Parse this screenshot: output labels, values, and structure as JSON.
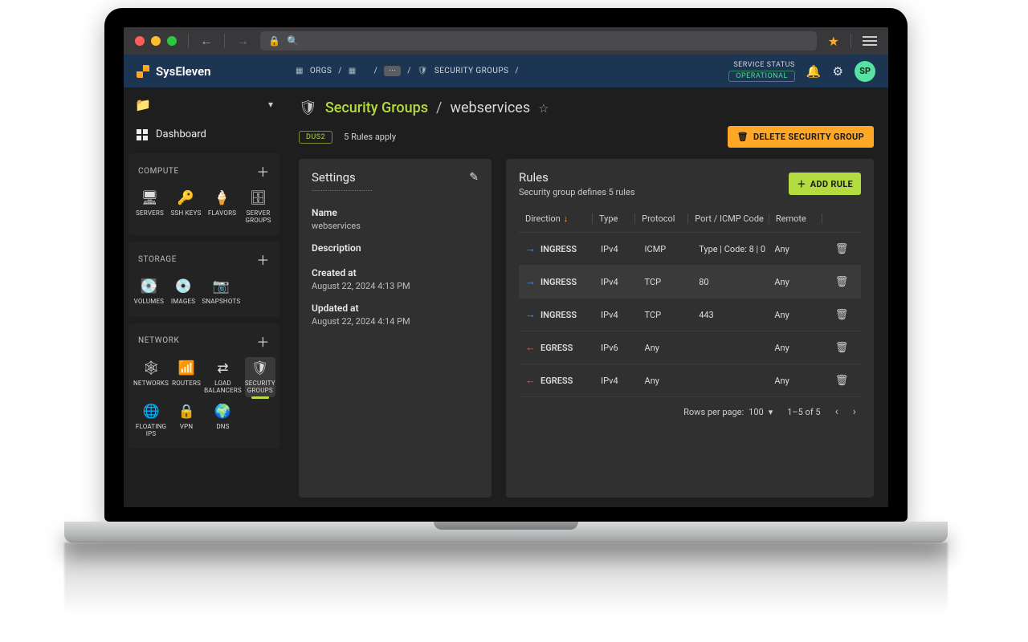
{
  "brand": "SysEleven",
  "browser": {
    "star_title": "Bookmark"
  },
  "breadcrumb": {
    "orgs": "ORGS",
    "security_groups": "SECURITY GROUPS"
  },
  "service_status": {
    "label": "SERVICE STATUS",
    "value": "OPERATIONAL"
  },
  "avatar": "SP",
  "sidebar": {
    "dashboard": "Dashboard",
    "compute": {
      "title": "COMPUTE",
      "items": [
        "SERVERS",
        "SSH KEYS",
        "FLAVORS",
        "SERVER GROUPS"
      ]
    },
    "storage": {
      "title": "STORAGE",
      "items": [
        "VOLUMES",
        "IMAGES",
        "SNAPSHOTS"
      ]
    },
    "network": {
      "title": "NETWORK",
      "items": [
        "NETWORKS",
        "ROUTERS",
        "LOAD BALANCERS",
        "SECURITY GROUPS",
        "FLOATING IPS",
        "VPN",
        "DNS"
      ]
    }
  },
  "page": {
    "section": "Security Groups",
    "name": "webservices",
    "region_tag": "DUS2",
    "rules_apply": "5 Rules apply",
    "delete_btn": "DELETE SECURITY GROUP"
  },
  "settings": {
    "title": "Settings",
    "name_label": "Name",
    "name_value": "webservices",
    "description_label": "Description",
    "description_value": "",
    "created_label": "Created at",
    "created_value": "August 22, 2024 4:13 PM",
    "updated_label": "Updated at",
    "updated_value": "August 22, 2024 4:14 PM"
  },
  "rules": {
    "title": "Rules",
    "subtitle": "Security group defines 5 rules",
    "add_btn": "ADD RULE",
    "columns": {
      "direction": "Direction",
      "type": "Type",
      "protocol": "Protocol",
      "port": "Port / ICMP Code",
      "remote": "Remote"
    },
    "rows": [
      {
        "direction": "INGRESS",
        "type": "IPv4",
        "protocol": "ICMP",
        "port": "Type | Code: 8 | 0",
        "remote": "Any"
      },
      {
        "direction": "INGRESS",
        "type": "IPv4",
        "protocol": "TCP",
        "port": "80",
        "remote": "Any"
      },
      {
        "direction": "INGRESS",
        "type": "IPv4",
        "protocol": "TCP",
        "port": "443",
        "remote": "Any"
      },
      {
        "direction": "EGRESS",
        "type": "IPv6",
        "protocol": "Any",
        "port": "",
        "remote": "Any"
      },
      {
        "direction": "EGRESS",
        "type": "IPv4",
        "protocol": "Any",
        "port": "",
        "remote": "Any"
      }
    ],
    "footer": {
      "rows_per_page_label": "Rows per page:",
      "rows_per_page_value": "100",
      "range": "1–5 of 5"
    }
  }
}
